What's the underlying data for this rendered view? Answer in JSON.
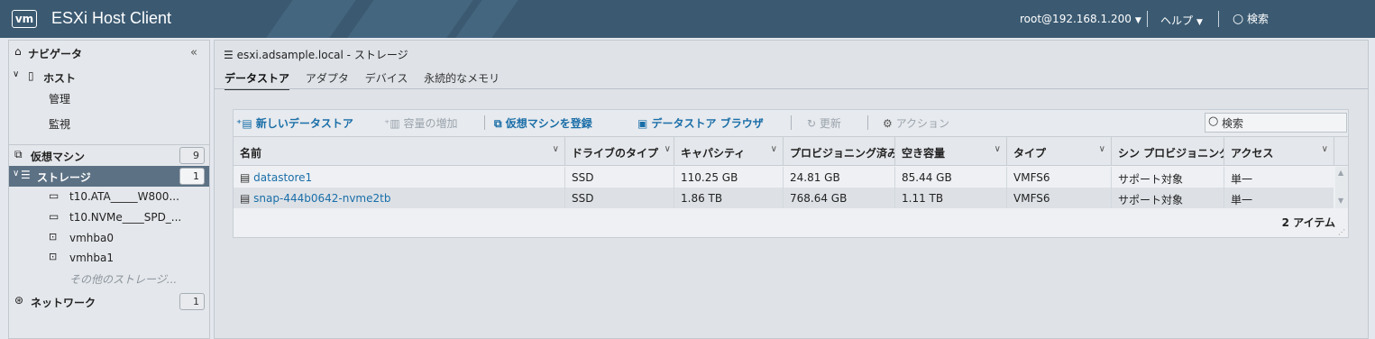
{
  "app": {
    "logo": "vm",
    "title": "ESXi Host Client"
  },
  "topbar": {
    "user": "root@192.168.1.200",
    "help": "ヘルプ",
    "search": "検索"
  },
  "navigator": {
    "title": "ナビゲータ",
    "items": [
      {
        "label": "ホスト",
        "icon": "host-icon"
      },
      {
        "label": "管理"
      },
      {
        "label": "監視"
      },
      {
        "label": "仮想マシン",
        "icon": "vm-icon",
        "count": "9"
      },
      {
        "label": "ストレージ",
        "icon": "storage-icon",
        "count": "1"
      },
      {
        "label": "t10.ATA_____W800...",
        "icon": "disk-icon"
      },
      {
        "label": "t10.NVMe____SPD_...",
        "icon": "disk-icon"
      },
      {
        "label": "vmhba0",
        "icon": "adapter-icon"
      },
      {
        "label": "vmhba1",
        "icon": "adapter-icon"
      },
      {
        "label": "その他のストレージ..."
      },
      {
        "label": "ネットワーク",
        "icon": "network-icon",
        "count": "1"
      }
    ]
  },
  "main": {
    "title": "esxi.adsample.local - ストレージ",
    "tabs": [
      "データストア",
      "アダプタ",
      "デバイス",
      "永続的なメモリ"
    ],
    "toolbar": {
      "new_datastore": "新しいデータストア",
      "increase_capacity": "容量の増加",
      "register_vm": "仮想マシンを登録",
      "datastore_browser": "データストア ブラウザ",
      "refresh": "更新",
      "actions": "アクション",
      "search_placeholder": "検索"
    },
    "grid": {
      "columns": [
        "名前",
        "ドライブのタイプ",
        "キャパシティ",
        "プロビジョニング済み",
        "空き容量",
        "タイプ",
        "シン プロビジョニング",
        "アクセス"
      ],
      "rows": [
        [
          "datastore1",
          "SSD",
          "110.25 GB",
          "24.81 GB",
          "85.44 GB",
          "VMFS6",
          "サポート対象",
          "単一"
        ],
        [
          "snap-444b0642-nvme2tb",
          "SSD",
          "1.86 TB",
          "768.64 GB",
          "1.11 TB",
          "VMFS6",
          "サポート対象",
          "単一"
        ]
      ],
      "footer": "2 アイテム"
    }
  }
}
